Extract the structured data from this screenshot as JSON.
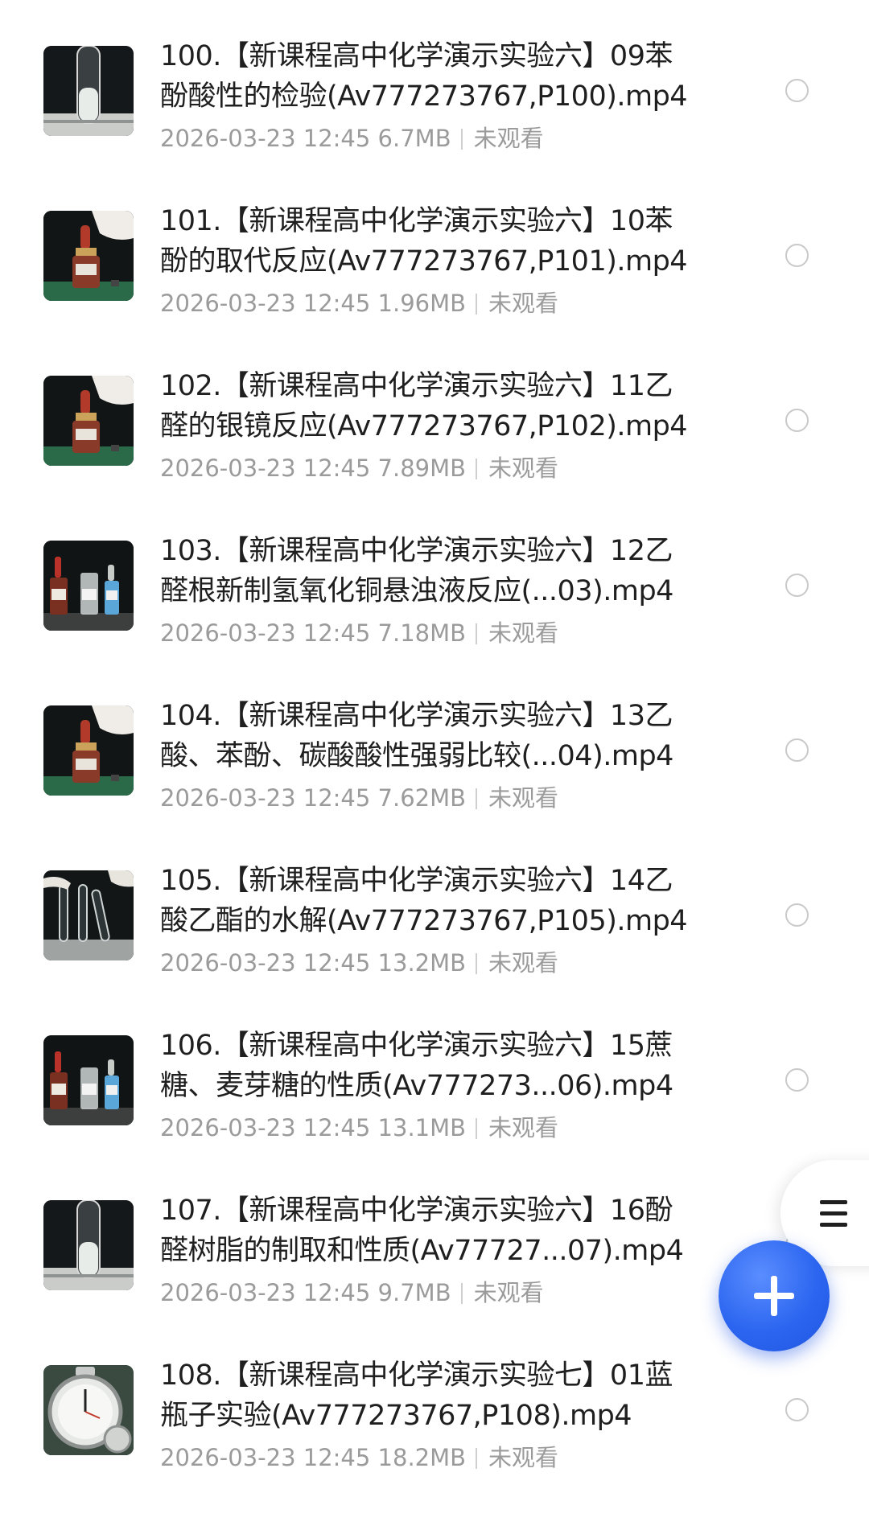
{
  "files": [
    {
      "title_line1": "100.【新课程高中化学演示实验六】09苯",
      "title_line2": "酚酸性的检验(Av777273767,P100).mp4",
      "date": "2026-03-23 12:45",
      "size": "6.7MB",
      "status": "未观看",
      "thumb": "tube"
    },
    {
      "title_line1": "101.【新课程高中化学演示实验六】10苯",
      "title_line2": "酚的取代反应(Av777273767,P101).mp4",
      "date": "2026-03-23 12:45",
      "size": "1.96MB",
      "status": "未观看",
      "thumb": "dropper-bottle"
    },
    {
      "title_line1": "102.【新课程高中化学演示实验六】11乙",
      "title_line2": "醛的银镜反应(Av777273767,P102).mp4",
      "date": "2026-03-23 12:45",
      "size": "7.89MB",
      "status": "未观看",
      "thumb": "dropper-bottle"
    },
    {
      "title_line1": "103.【新课程高中化学演示实验六】12乙",
      "title_line2": "醛根新制氢氧化铜悬浊液反应(...03).mp4",
      "date": "2026-03-23 12:45",
      "size": "7.18MB",
      "status": "未观看",
      "thumb": "three-bottles"
    },
    {
      "title_line1": "104.【新课程高中化学演示实验六】13乙",
      "title_line2": "酸、苯酚、碳酸酸性强弱比较(...04).mp4",
      "date": "2026-03-23 12:45",
      "size": "7.62MB",
      "status": "未观看",
      "thumb": "dropper-bottle"
    },
    {
      "title_line1": "105.【新课程高中化学演示实验六】14乙",
      "title_line2": "酸乙酯的水解(Av777273767,P105).mp4",
      "date": "2026-03-23 12:45",
      "size": "13.2MB",
      "status": "未观看",
      "thumb": "test-tubes"
    },
    {
      "title_line1": "106.【新课程高中化学演示实验六】15蔗",
      "title_line2": "糖、麦芽糖的性质(Av777273...06).mp4",
      "date": "2026-03-23 12:45",
      "size": "13.1MB",
      "status": "未观看",
      "thumb": "three-bottles"
    },
    {
      "title_line1": "107.【新课程高中化学演示实验六】16酚",
      "title_line2": "醛树脂的制取和性质(Av77727...07).mp4",
      "date": "2026-03-23 12:45",
      "size": "9.7MB",
      "status": "未观看",
      "thumb": "tube"
    },
    {
      "title_line1": "108.【新课程高中化学演示实验七】01蓝",
      "title_line2": "瓶子实验(Av777273767,P108).mp4",
      "date": "2026-03-23 12:45",
      "size": "18.2MB",
      "status": "未观看",
      "thumb": "stopwatch"
    }
  ],
  "colors": {
    "title": "#1f1f1f",
    "meta": "#9b9b9b",
    "accent": "#2c66f0"
  },
  "icons": {
    "menu": "menu-icon",
    "add": "plus-icon",
    "select": "radio-icon"
  }
}
